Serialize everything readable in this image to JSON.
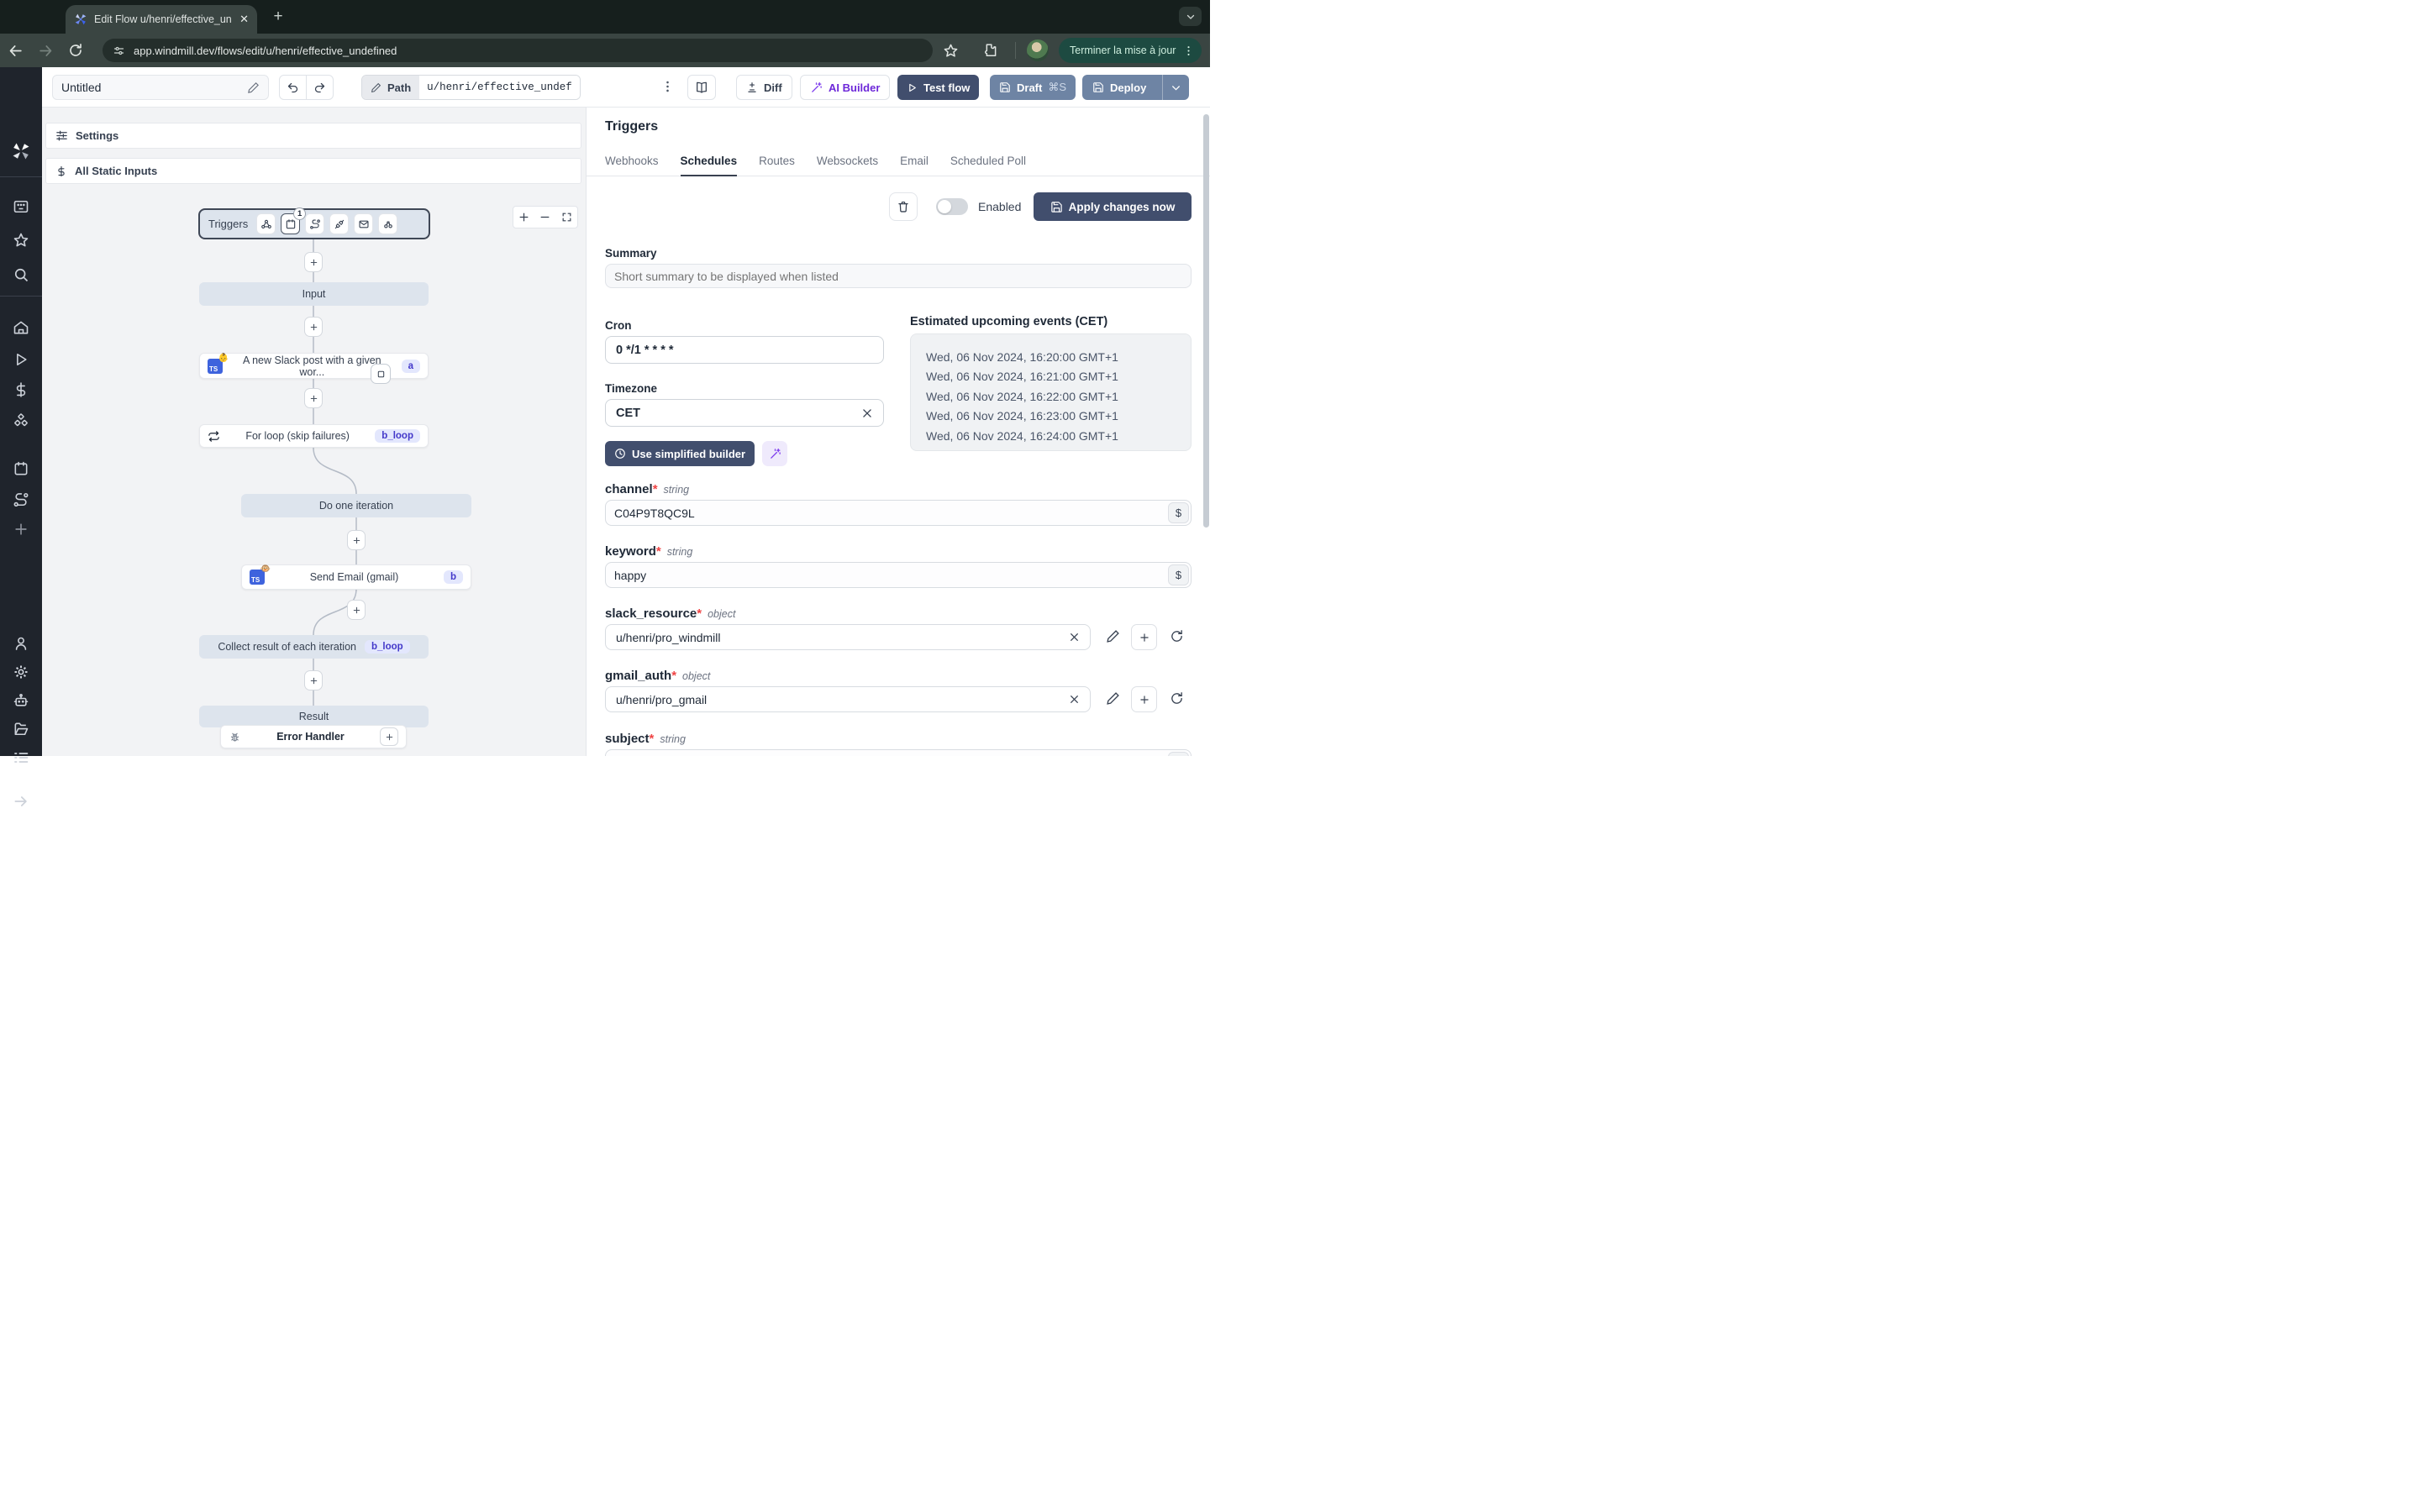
{
  "browser": {
    "tab_title": "Edit Flow u/henri/effective_un",
    "url": "app.windmill.dev/flows/edit/u/henri/effective_undefined",
    "update_button": "Terminer la mise à jour"
  },
  "toolbar": {
    "title": "Untitled",
    "path_label": "Path",
    "path_value": "u/henri/effective_undef",
    "diff_label": "Diff",
    "ai_builder_label": "AI Builder",
    "test_flow_label": "Test flow",
    "draft_label": "Draft",
    "draft_shortcut": "⌘S",
    "deploy_label": "Deploy"
  },
  "flow": {
    "settings_label": "Settings",
    "static_inputs_label": "All Static Inputs",
    "triggers_label": "Triggers",
    "trigger_badge": "1",
    "ts_label": "TS",
    "nodes": {
      "input": "Input",
      "slack": {
        "label": "A new Slack post with a given wor...",
        "badge": "a"
      },
      "forloop": {
        "label": "For loop (skip failures)",
        "badge": "b_loop"
      },
      "iteration": "Do one iteration",
      "email": {
        "label": "Send Email (gmail)",
        "badge": "b"
      },
      "collect": {
        "label": "Collect result of each iteration",
        "badge": "b_loop"
      },
      "result": "Result",
      "error_handler": "Error Handler"
    }
  },
  "panel": {
    "title": "Triggers",
    "tabs": [
      "Webhooks",
      "Schedules",
      "Routes",
      "Websockets",
      "Email",
      "Scheduled Poll"
    ],
    "enabled_label": "Enabled",
    "apply_button": "Apply changes now",
    "summary_label": "Summary",
    "summary_placeholder": "Short summary to be displayed when listed",
    "cron_label": "Cron",
    "cron_value": "0 */1 * * * *",
    "timezone_label": "Timezone",
    "timezone_value": "CET",
    "builder_button": "Use simplified builder",
    "events_title": "Estimated upcoming events (CET)",
    "events": [
      "Wed, 06 Nov 2024, 16:20:00 GMT+1",
      "Wed, 06 Nov 2024, 16:21:00 GMT+1",
      "Wed, 06 Nov 2024, 16:22:00 GMT+1",
      "Wed, 06 Nov 2024, 16:23:00 GMT+1",
      "Wed, 06 Nov 2024, 16:24:00 GMT+1"
    ],
    "dollar": "$",
    "required_marker": "*",
    "fields": {
      "channel": {
        "name": "channel",
        "type": "string",
        "value": "C04P9T8QC9L"
      },
      "keyword": {
        "name": "keyword",
        "type": "string",
        "value": "happy"
      },
      "slack_resource": {
        "name": "slack_resource",
        "type": "object",
        "value": "u/henri/pro_windmill"
      },
      "gmail_auth": {
        "name": "gmail_auth",
        "type": "object",
        "value": "u/henri/pro_gmail"
      },
      "subject": {
        "name": "subject",
        "type": "string",
        "value": ""
      }
    }
  }
}
